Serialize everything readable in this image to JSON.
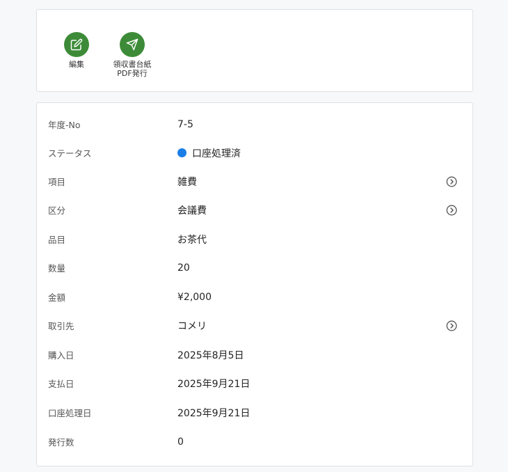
{
  "actions": [
    {
      "label": "編集",
      "icon": "edit-icon"
    },
    {
      "label_line1": "領収書台紙",
      "label_line2": "PDF発行",
      "icon": "send-icon"
    }
  ],
  "fields": {
    "fiscal_no": {
      "label": "年度-No",
      "value": "7-5"
    },
    "status": {
      "label": "ステータス",
      "value": "口座処理済",
      "color": "#1a7ee6"
    },
    "item": {
      "label": "項目",
      "value": "雑費"
    },
    "category": {
      "label": "区分",
      "value": "会議費"
    },
    "product": {
      "label": "品目",
      "value": "お茶代"
    },
    "quantity": {
      "label": "数量",
      "value": "20"
    },
    "amount": {
      "label": "金額",
      "value": "¥2,000"
    },
    "vendor": {
      "label": "取引先",
      "value": "コメリ"
    },
    "purchase_date": {
      "label": "購入日",
      "value": "2025年8月5日"
    },
    "payment_date": {
      "label": "支払日",
      "value": "2025年9月21日"
    },
    "account_date": {
      "label": "口座処理日",
      "value": "2025年9月21日"
    },
    "issue_count": {
      "label": "発行数",
      "value": "0"
    }
  },
  "colors": {
    "action_green": "#3d8b38",
    "status_blue": "#1a7ee6"
  }
}
